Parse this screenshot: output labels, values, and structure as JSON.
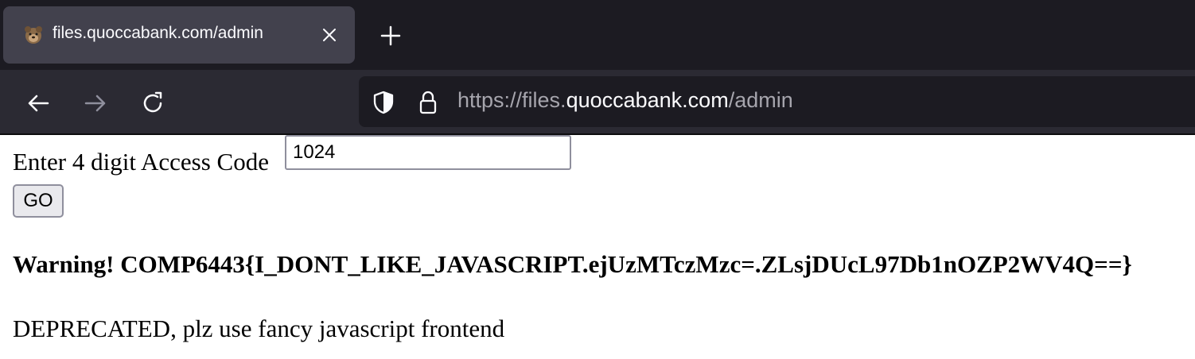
{
  "browser": {
    "tab": {
      "title": "files.quoccabank.com/admin"
    },
    "url": {
      "scheme_prefix": "https://files.",
      "host": "quoccabank.com",
      "path": "/admin"
    },
    "colors": {
      "tabbar": "#1c1b22",
      "active_tab": "#42414d",
      "navbar": "#2b2a33",
      "text": "#fbfbfe",
      "dim_text": "#a6a5ad"
    }
  },
  "form": {
    "label": "Enter 4 digit Access Code",
    "input_value": "1024",
    "submit_label": "GO"
  },
  "warning": "Warning! COMP6443{I_DONT_LIKE_JAVASCRIPT.ejUzMTczMzc=.ZLsjDUcL97Db1nOZP2WV4Q==}",
  "notice": "DEPRECATED, plz use fancy javascript frontend"
}
